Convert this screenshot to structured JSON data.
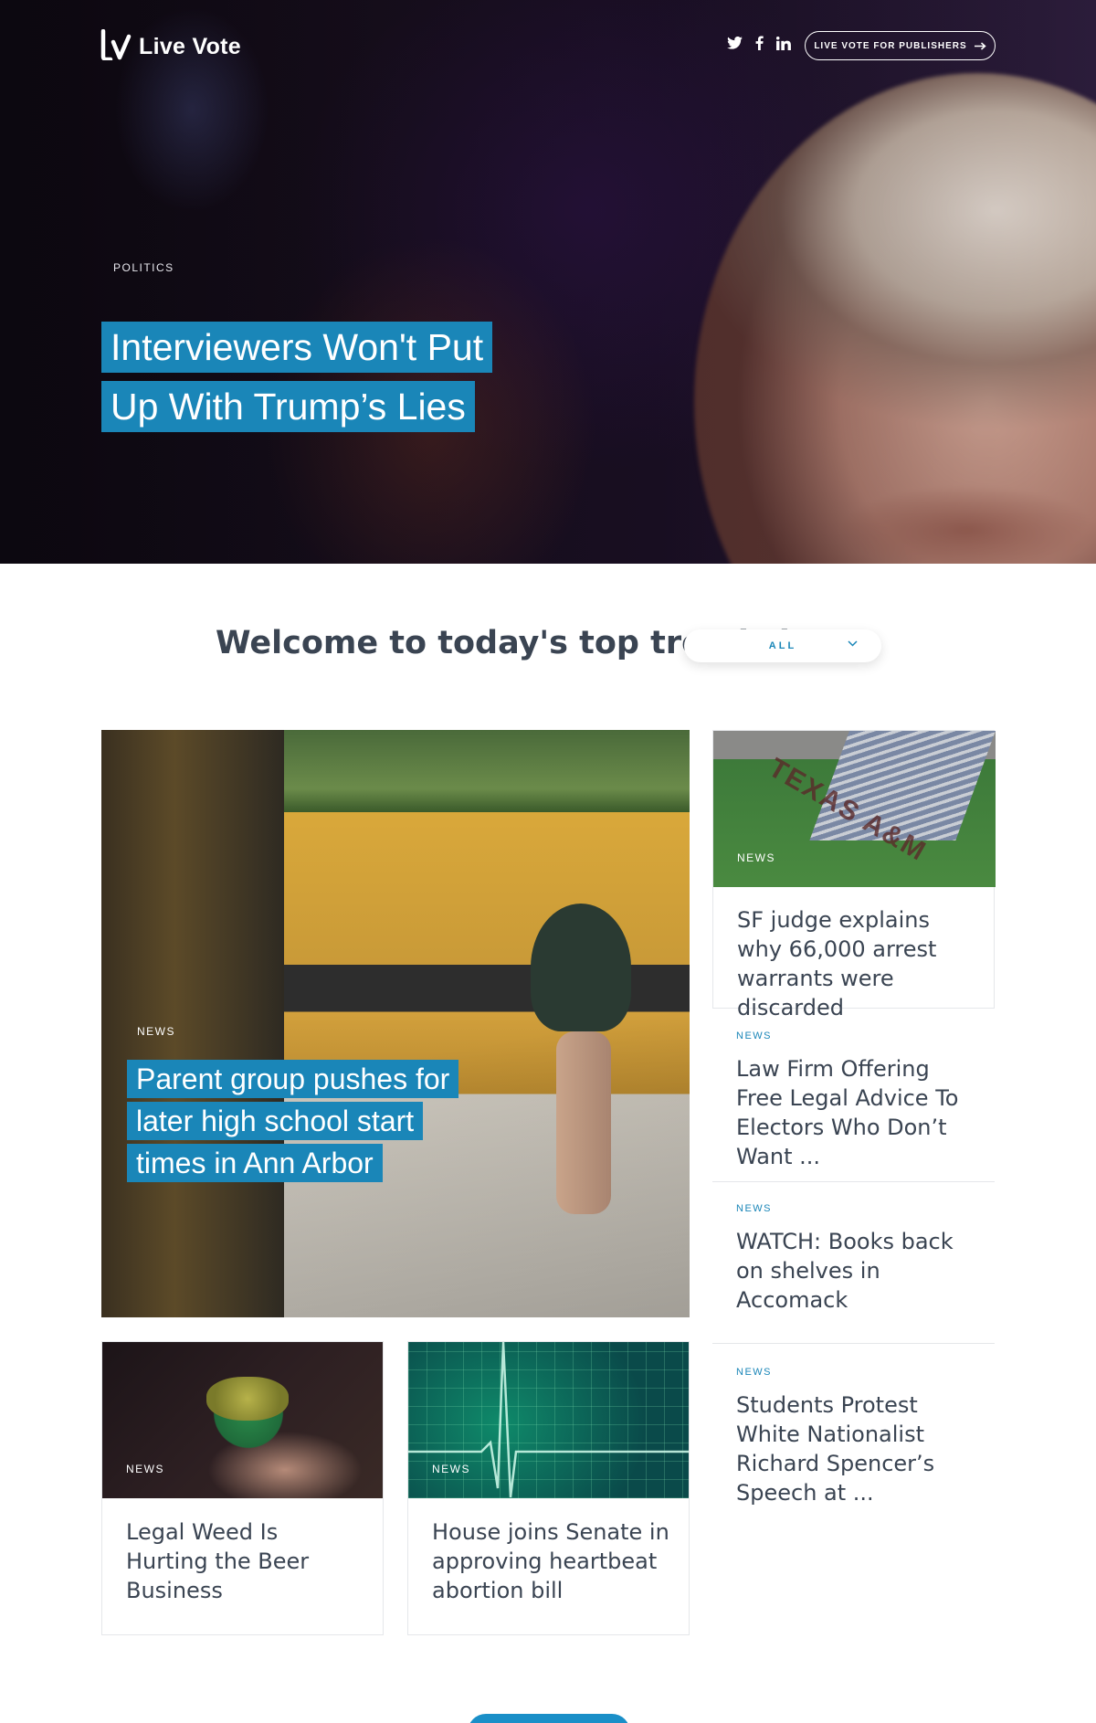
{
  "header": {
    "logo_text": "Live Vote",
    "social_icons": [
      "twitter-icon",
      "facebook-icon",
      "linkedin-icon"
    ],
    "publishers_button": "LIVE VOTE FOR PUBLISHERS"
  },
  "hero": {
    "category": "POLITICS",
    "title_lines": [
      "Interviewers Won't Put",
      "Up With Trump’s  Lies"
    ]
  },
  "welcome": {
    "text": "Welcome to today's top trends in",
    "dropdown_value": "ALL"
  },
  "feature": {
    "category": "NEWS",
    "title_lines": [
      "Parent group pushes for",
      "later high school start",
      "times in Ann Arbor"
    ]
  },
  "side_card": {
    "category": "NEWS",
    "title": "SF judge explains why 66,000 arrest warrants were discarded"
  },
  "side_list": [
    {
      "category": "NEWS",
      "title": "Law Firm Offering Free Legal Advice To Electors Who Don’t Want ..."
    },
    {
      "category": "NEWS",
      "title": "WATCH: Books back on shelves in Accomack"
    },
    {
      "category": "NEWS",
      "title": "Students Protest White Nationalist Richard Spencer’s Speech at ..."
    }
  ],
  "bottom_cards": [
    {
      "category": "NEWS",
      "title": "Legal Weed Is Hurting the Beer Business"
    },
    {
      "category": "NEWS",
      "title": "House joins Senate in approving heartbeat abortion bill"
    }
  ],
  "colors": {
    "accent": "#1a86b8",
    "text": "#3a4452",
    "border": "#e5e7ea"
  }
}
